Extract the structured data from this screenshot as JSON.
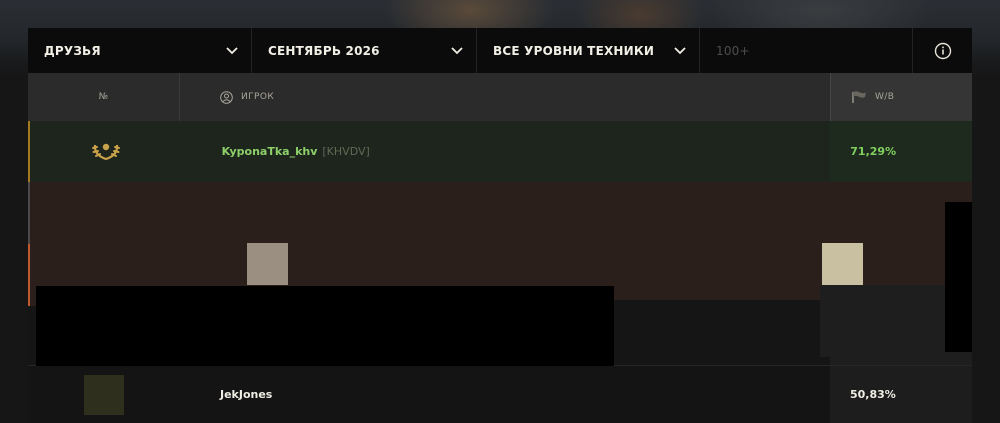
{
  "filters": {
    "group": "ДРУЗЬЯ",
    "period": "СЕНТЯБРЬ 2026",
    "tiers": "ВСЕ УРОВНИ ТЕХНИКИ",
    "min_battles": "100+"
  },
  "table": {
    "columns": {
      "rank": "№",
      "player": "ИГРОК",
      "winrate": "W/B"
    },
    "rows": [
      {
        "rank_icon": "gold-laurel-icon",
        "name": "KyponaTka_khv",
        "clan": "[KHVDV]",
        "winrate": "71,29%"
      },
      {
        "rank_icon": "",
        "name": "",
        "clan": "",
        "winrate": ""
      },
      {
        "rank_icon": "",
        "name": "",
        "clan": "",
        "winrate": ""
      },
      {
        "rank_icon": "",
        "name": "",
        "clan": "",
        "winrate": ""
      },
      {
        "rank_icon": "",
        "name": "JekJones",
        "clan": "",
        "winrate": "50,83%"
      }
    ]
  },
  "colors": {
    "accent_gold": "#c9a24a",
    "winrate_green": "#7fcf5f",
    "row1_highlight": "#1d251d",
    "row_brown": "#2a1f1b"
  }
}
